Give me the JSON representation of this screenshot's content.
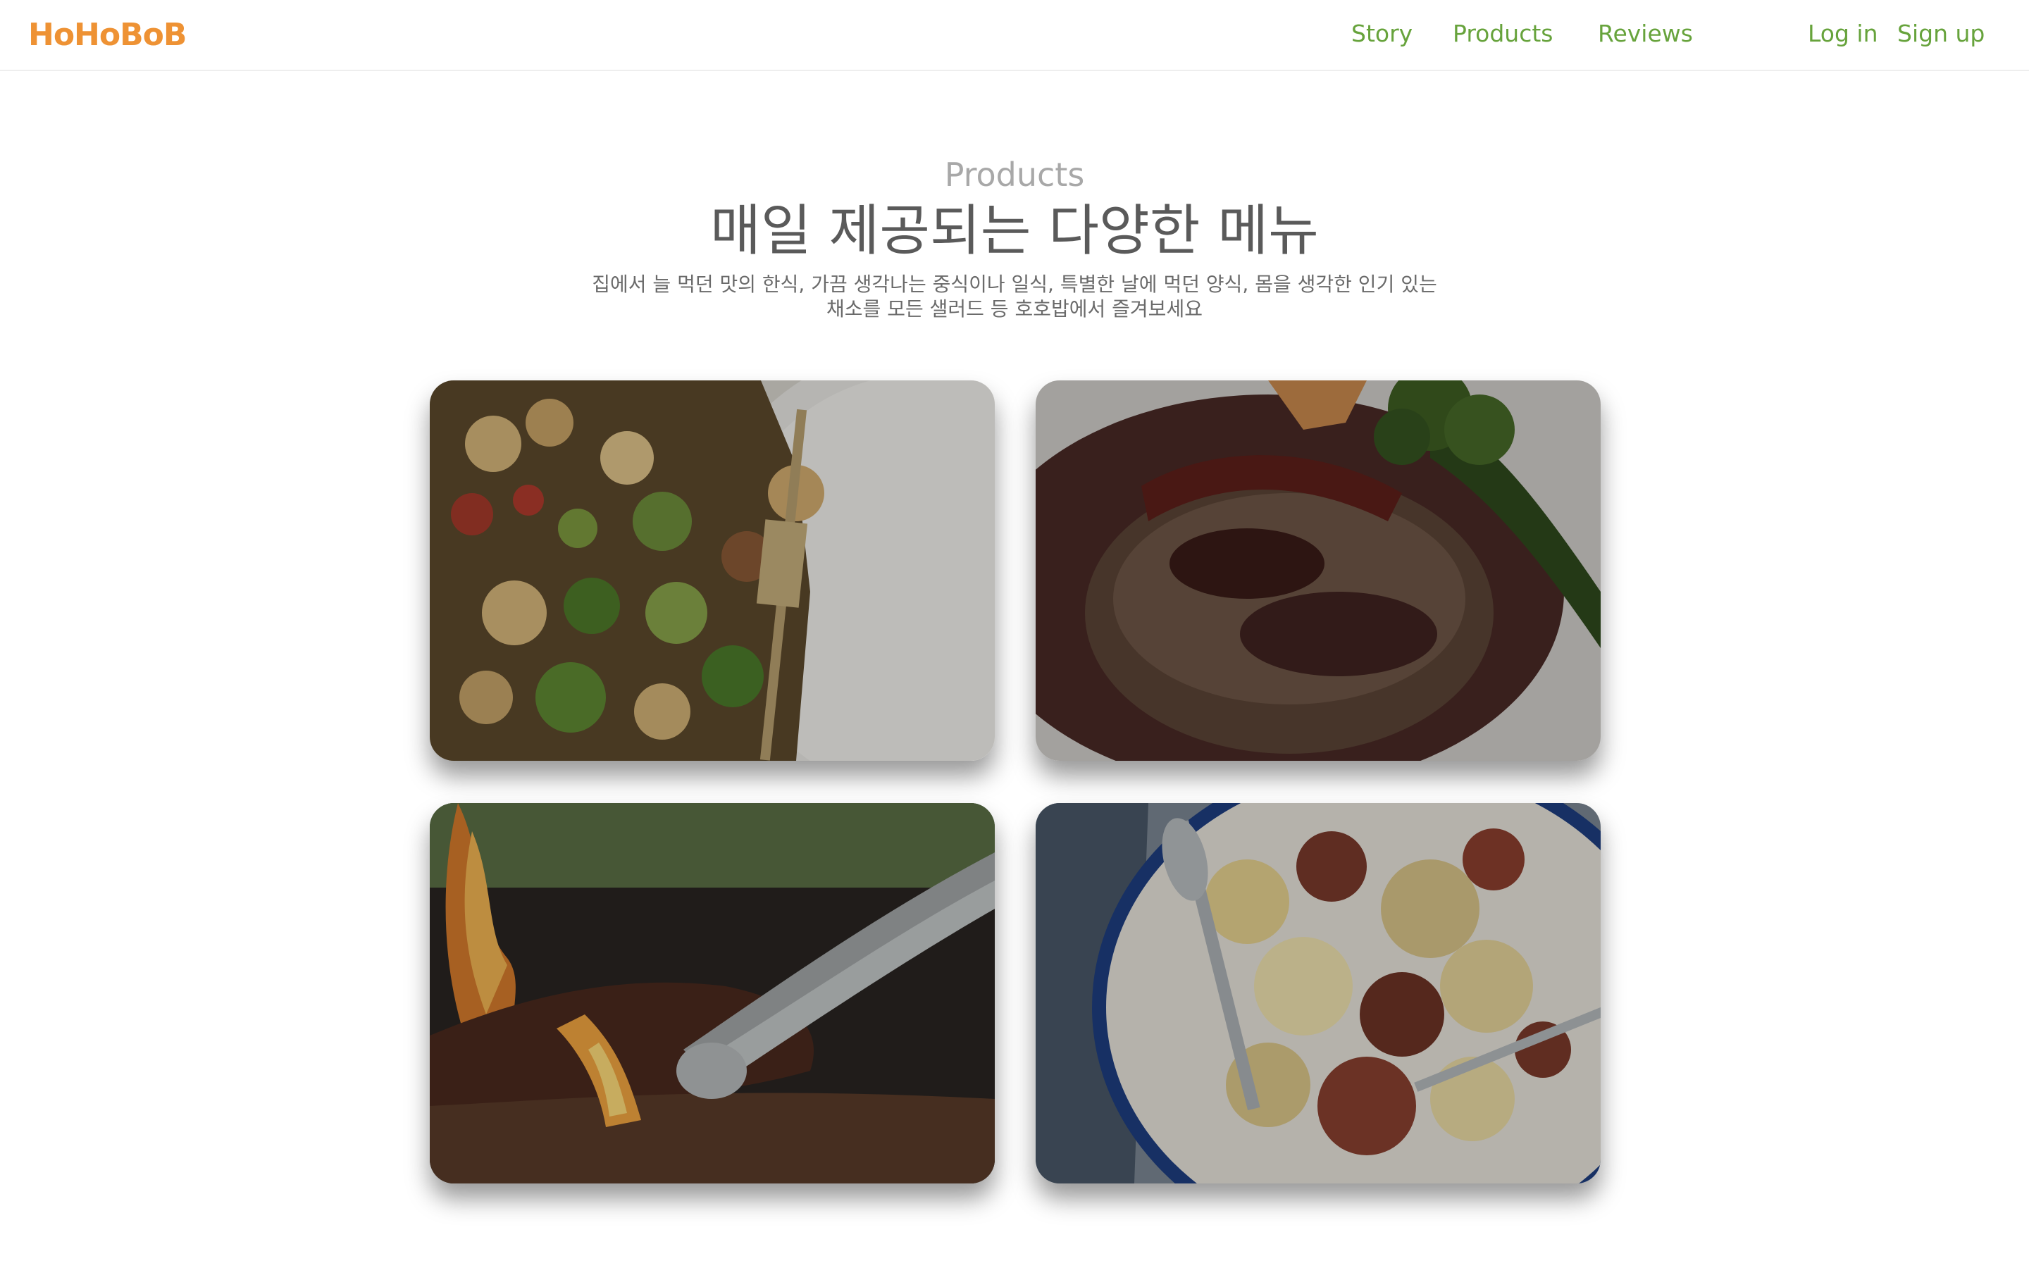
{
  "header": {
    "logo": "HoHoBoB",
    "nav": {
      "story": "Story",
      "products": "Products",
      "reviews": "Reviews"
    },
    "auth": {
      "login": "Log in",
      "signup": "Sign up"
    }
  },
  "section": {
    "label": "Products",
    "title": "매일 제공되는 다양한 메뉴",
    "description": "집에서 늘 먹던 맛의 한식, 가끔 생각나는 중식이나 일식, 특별한 날에 먹던 양식, 몸을 생각한 인기 있는 채소를 모든 샐러드 등 호호밥에서 즐겨보세요"
  },
  "cards": [
    {
      "icon": "salad-photo"
    },
    {
      "icon": "steak-photo"
    },
    {
      "icon": "grilled-meat-photo"
    },
    {
      "icon": "fries-photo"
    }
  ],
  "colors": {
    "brand": "#ee9234",
    "nav": "#67a33c",
    "label": "#a8a8a8",
    "title": "#5a5a5a"
  }
}
